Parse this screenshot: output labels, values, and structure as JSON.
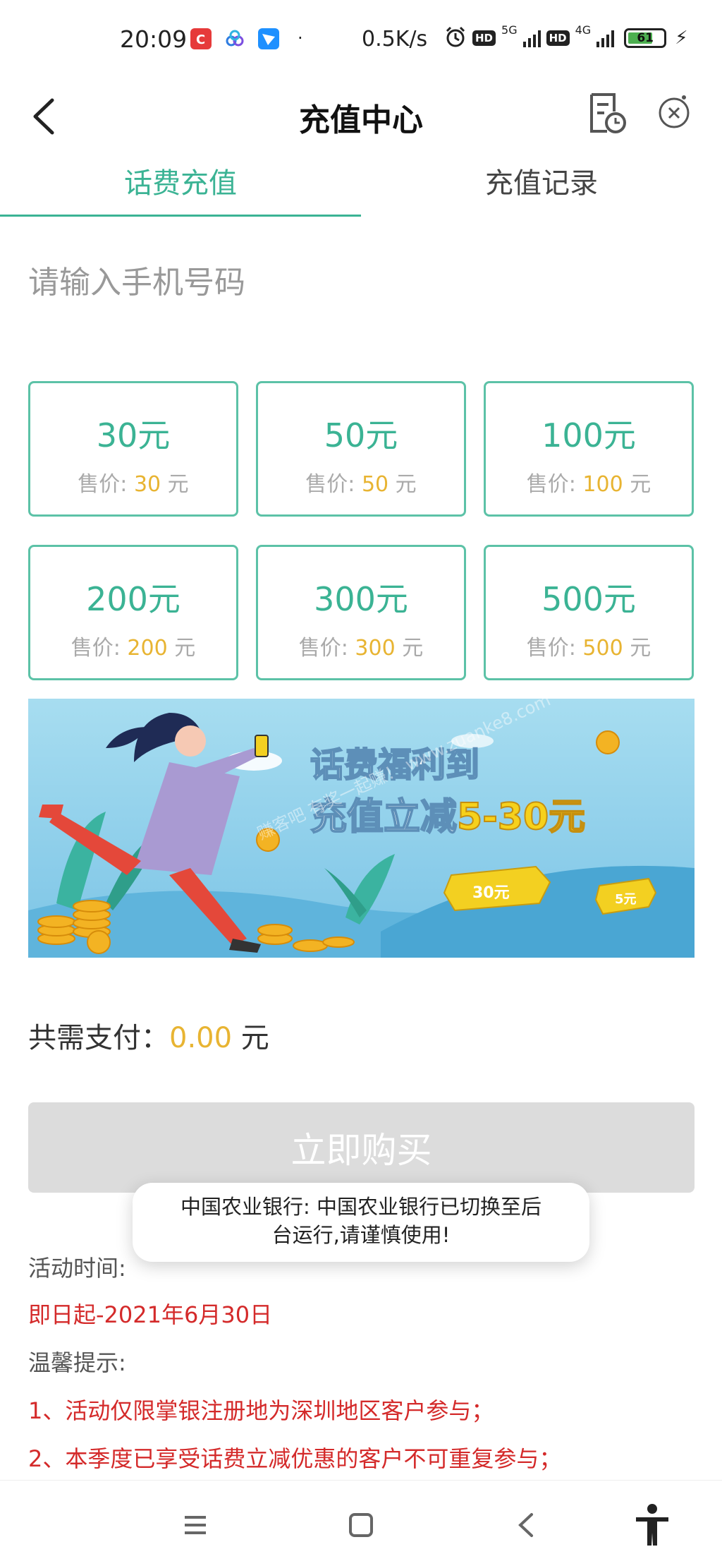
{
  "status_bar": {
    "time": "20:09",
    "dot": "·",
    "net_speed": "0.5K/s",
    "badge_1": "HD",
    "net_1": "5G",
    "badge_2": "HD",
    "net_2": "4G",
    "battery_level": "61",
    "charging_icon": "bolt-icon",
    "app_icons": [
      "app-red-icon",
      "app-blue-cluster-icon",
      "app-blue-arrow-icon"
    ]
  },
  "header": {
    "title": "充值中心",
    "back_icon": "chevron-left-icon",
    "history_icon": "document-clock-icon",
    "close_icon": "circle-close-icon"
  },
  "tabs": [
    {
      "label": "话费充值",
      "active": true
    },
    {
      "label": "充值记录",
      "active": false
    }
  ],
  "phone_input": {
    "placeholder": "请输入手机号码",
    "value": ""
  },
  "price_label": "售价: ",
  "price_unit": " 元",
  "amounts": [
    {
      "label": "30元",
      "price": "30"
    },
    {
      "label": "50元",
      "price": "50"
    },
    {
      "label": "100元",
      "price": "100"
    },
    {
      "label": "200元",
      "price": "200"
    },
    {
      "label": "300元",
      "price": "300"
    },
    {
      "label": "500元",
      "price": "500"
    }
  ],
  "banner": {
    "line1": "话费福利到",
    "line2_prefix": "充值立减",
    "line2_highlight": "5-30元",
    "ribbon_1": "30元",
    "ribbon_2": "5元",
    "watermark": "赚客吧 有奖一起赚！ www.zuanke8.com"
  },
  "total": {
    "label": "共需支付：",
    "amount": "0.00",
    "unit": " 元"
  },
  "buy_button": "立即购买",
  "info": {
    "period_label": "活动时间:",
    "period_value": "即日起-2021年6月30日",
    "tips_label": "温馨提示:",
    "tip_1": "1、活动仅限掌银注册地为深圳地区客户参与；",
    "tip_2": "2、本季度已享受话费立减优惠的客户不可重复参与；"
  },
  "toast": {
    "line1": "中国农业银行: 中国农业银行已切换至后",
    "line2": "台运行,请谨慎使用!"
  },
  "nav_bar": [
    "menu-icon",
    "home-square-icon",
    "back-triangle-icon",
    "accessibility-icon"
  ],
  "colors": {
    "accent": "#3bb394",
    "price": "#e8b432",
    "warning": "#d42a2a",
    "disabled": "#dcdcdc"
  }
}
